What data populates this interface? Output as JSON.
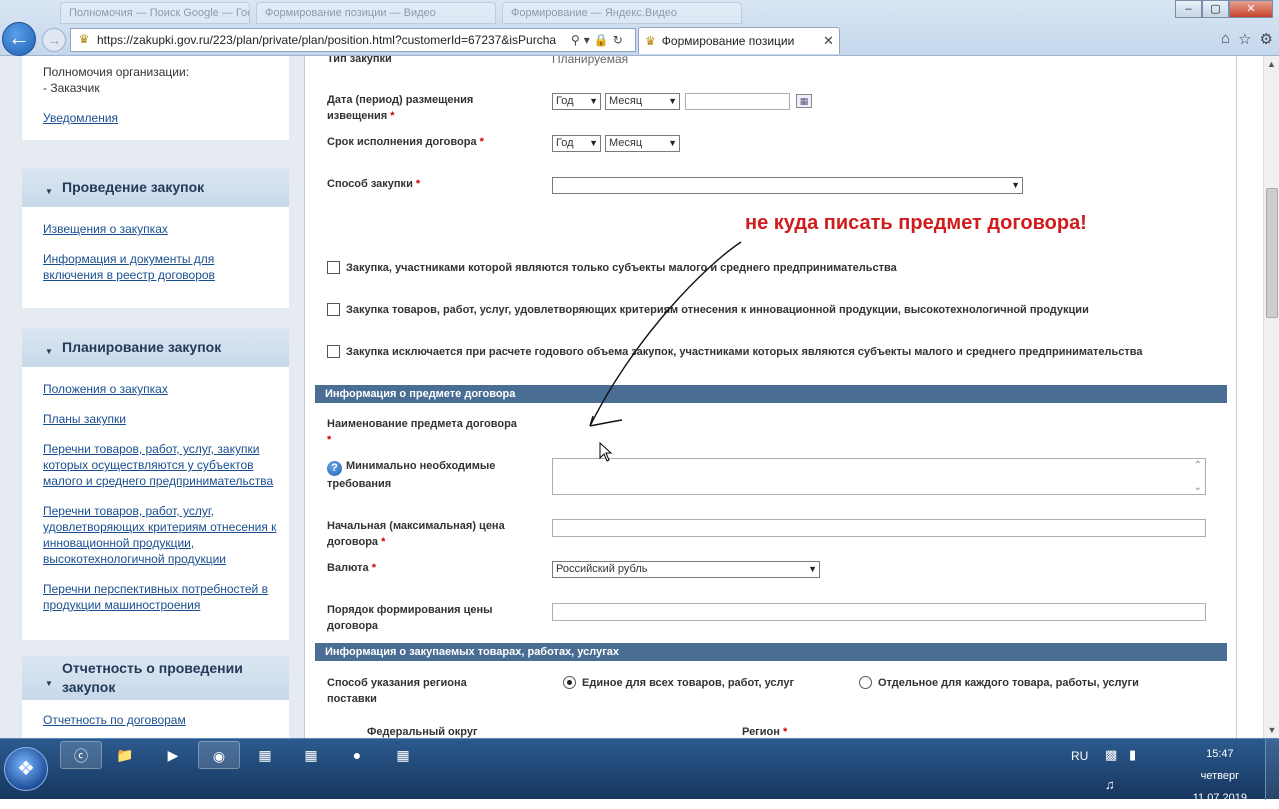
{
  "browser": {
    "url": "https://zakupki.gov.ru/223/plan/private/plan/position.html?customerId=67237&isPurcha",
    "active_tab_title": "Формирование позиции",
    "ghost_tabs": [
      "Полномочия — Поиск Google — Гос",
      "Формирование позиции — Видео",
      "Формирование — Яндекс.Видео"
    ],
    "window_buttons": [
      "–",
      "▢",
      "✕"
    ]
  },
  "sidebar": {
    "top_text_1": "Полномочия организации:",
    "top_text_2": "- Заказчик",
    "top_link": "Уведомления",
    "block_conduct": {
      "title": "Проведение закупок",
      "links": [
        "Извещения о закупках",
        "Информация и документы для включения в реестр договоров"
      ]
    },
    "block_planning": {
      "title": "Планирование закупок",
      "links": [
        "Положения о закупках",
        "Планы закупки",
        "Перечни товаров, работ, услуг, закупки которых осуществляются у субъектов малого и среднего предпринимательства",
        "Перечни товаров, работ, услуг, удовлетворяющих критериям отнесения к инновационной продукции, высокотехнологичной продукции",
        "Перечни перспективных потребностей в продукции машиностроения"
      ]
    },
    "block_reporting": {
      "title": "Отчетность о проведении закупок",
      "links": [
        "Отчетность по договорам"
      ]
    }
  },
  "form": {
    "purchase_type_label": "Тип закупки",
    "purchase_type_value": "Планируемая",
    "notice_date_label": "Дата (период) размещения извещения",
    "year_placeholder": "Год",
    "month_placeholder": "Месяц",
    "contract_term_label": "Срок исполнения договора",
    "method_label": "Способ закупки",
    "req_mark": "*",
    "checkboxes": [
      "Закупка, участниками которой являются только субъекты малого и среднего предпринимательства",
      "Закупка товаров, работ, услуг, удовлетворяющих критериям отнесения к инновационной продукции, высокотехнологичной продукции",
      "Закупка исключается при расчете годового объема закупок, участниками которых являются субъекты малого и среднего предпринимательства"
    ],
    "section_subject": "Информация о предмете договора",
    "subject_name_label": "Наименование предмета договора",
    "min_req_label": "Минимально необходимые требования",
    "price_label": "Начальная (максимальная) цена договора",
    "currency_label": "Валюта",
    "currency_value": "Российский рубль",
    "pricing_label": "Порядок формирования цены договора",
    "section_goods": "Информация о закупаемых товарах, работах, услугах",
    "region_method_label": "Способ указания региона поставки",
    "radio_single": "Единое для всех товаров, работ, услуг",
    "radio_each": "Отдельное для каждого товара, работы, услуги",
    "federal_district_label": "Федеральный округ",
    "region_label": "Регион"
  },
  "annotation": "не куда писать предмет договора!",
  "taskbar": {
    "lang": "RU",
    "time": "15:47",
    "weekday": "четверг",
    "date": "11.07.2019"
  }
}
